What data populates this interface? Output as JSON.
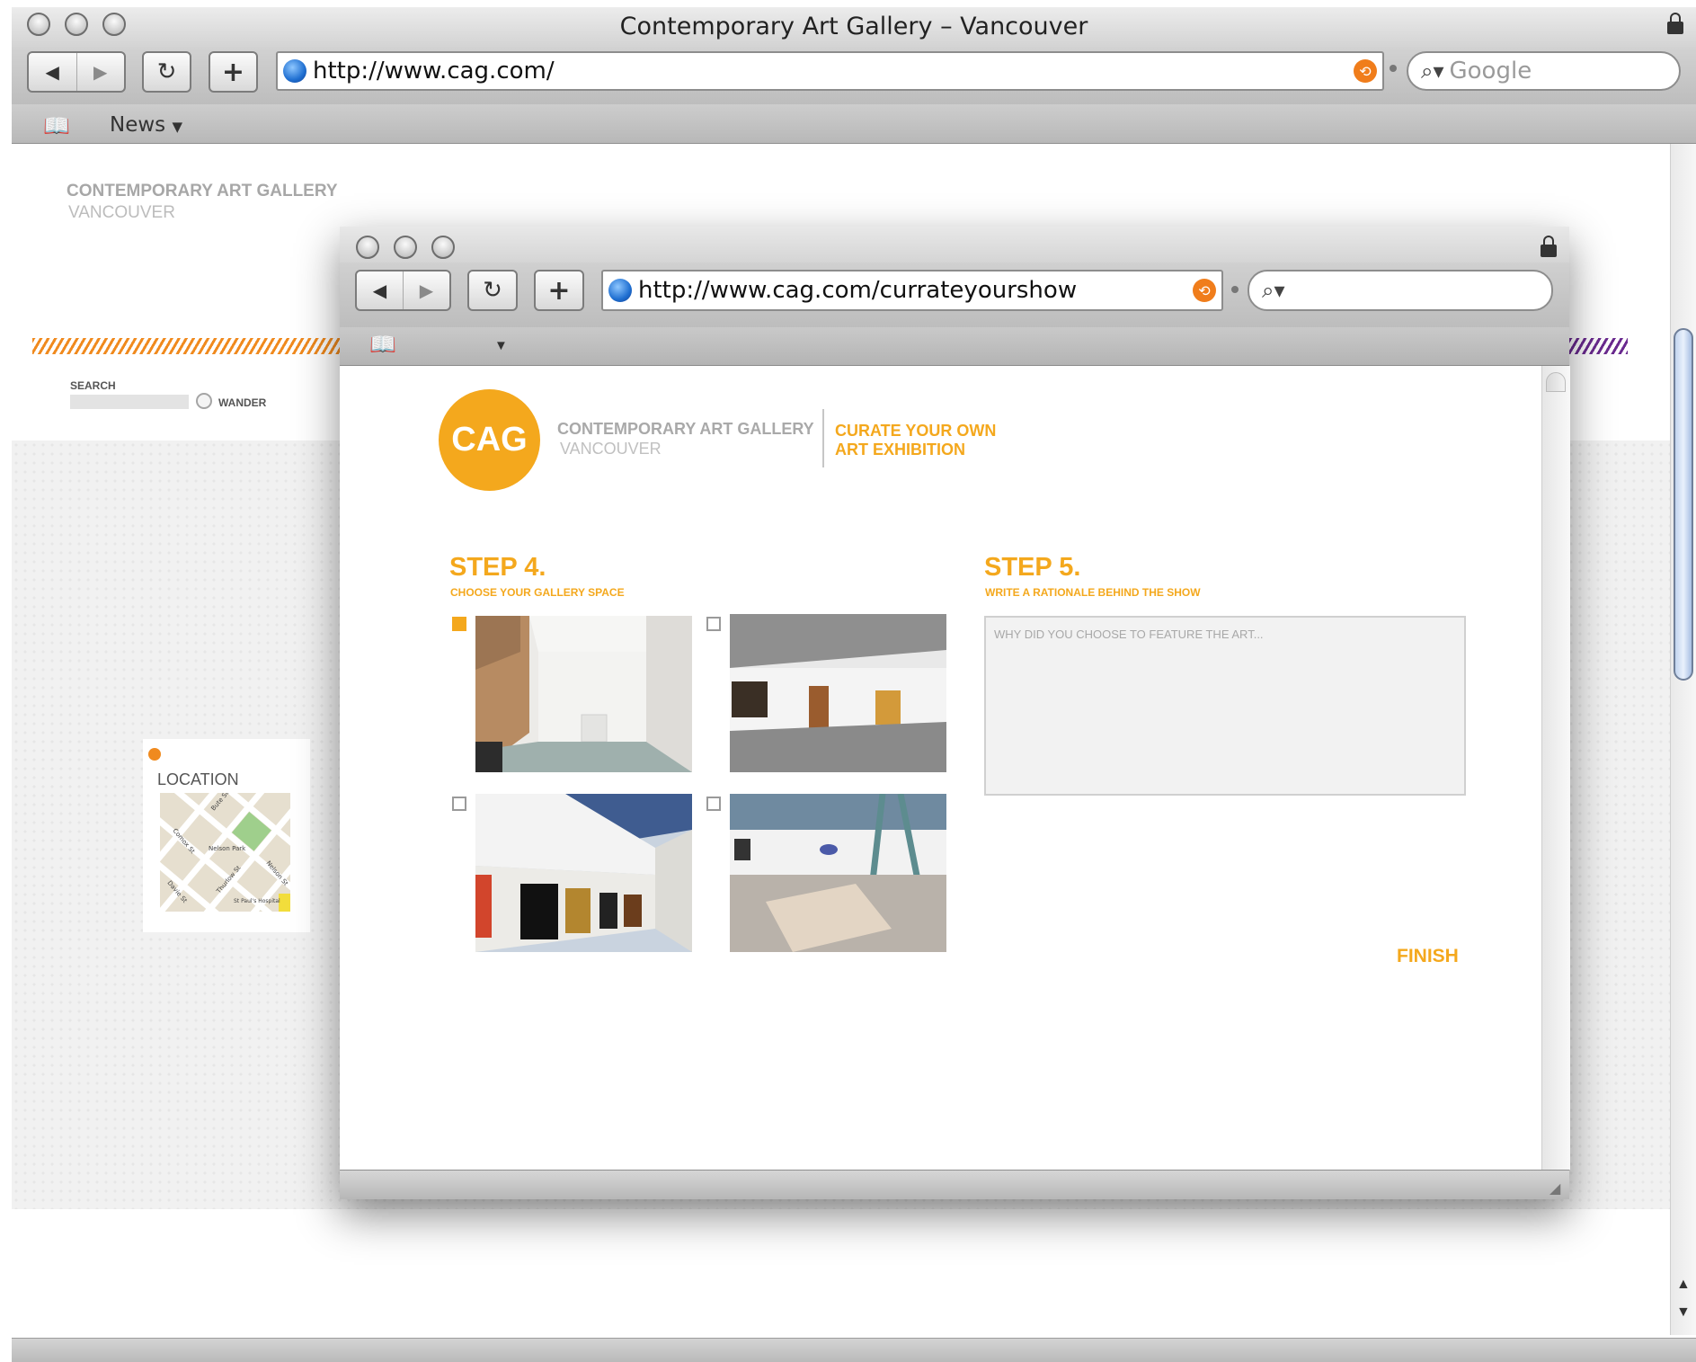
{
  "outer_browser": {
    "title": "Contemporary Art Gallery – Vancouver",
    "url": "http://www.cag.com/",
    "search_placeholder": "Google",
    "bookmarks": [
      {
        "label": "News"
      }
    ]
  },
  "outer_page": {
    "brand_line1": "CONTEMPORARY ART GALLERY",
    "brand_line2": "VANCOUVER",
    "search_label": "SEARCH",
    "wander_label": "WANDER",
    "location_label": "LOCATION",
    "map_labels": [
      "Bute St",
      "Comox St",
      "Nelson Park",
      "Nelson St",
      "Thurlow St",
      "Davie St",
      "St Paul's Hospital"
    ]
  },
  "inner_browser": {
    "url": "http://www.cag.com/currateyourshow",
    "search_placeholder": ""
  },
  "inner_page": {
    "logo_text": "CAG",
    "brand_line1": "CONTEMPORARY ART GALLERY",
    "brand_line2": "VANCOUVER",
    "tagline_line1": "CURATE YOUR OWN",
    "tagline_line2": "ART EXHIBITION",
    "step4": {
      "title": "STEP 4.",
      "subtitle": "CHOOSE YOUR GALLERY SPACE",
      "spaces": [
        {
          "name": "gallery-space-1",
          "selected": true
        },
        {
          "name": "gallery-space-2",
          "selected": false
        },
        {
          "name": "gallery-space-3",
          "selected": false
        },
        {
          "name": "gallery-space-4",
          "selected": false
        }
      ]
    },
    "step5": {
      "title": "STEP 5.",
      "subtitle": "WRITE A RATIONALE BEHIND THE SHOW",
      "placeholder": "WHY DID YOU CHOOSE TO FEATURE THE ART..."
    },
    "finish_label": "FINISH"
  },
  "colors": {
    "accent": "#f4a81d",
    "stripe_orange": "#f08a1e",
    "stripe_purple": "#6a2a8f"
  }
}
